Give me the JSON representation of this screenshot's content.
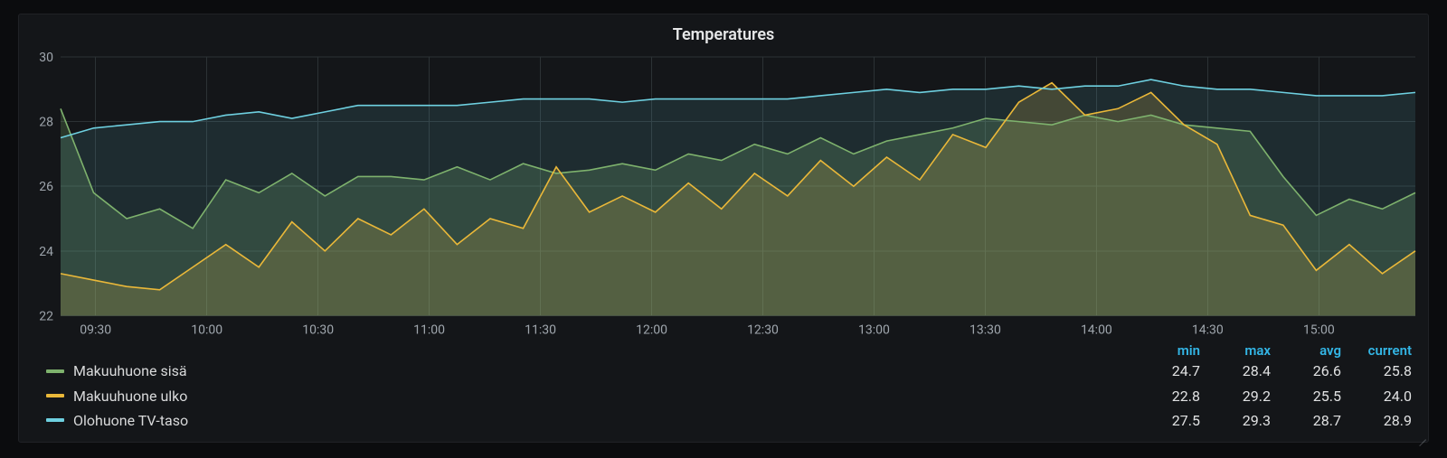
{
  "title": "Temperatures",
  "legend_headers": [
    "min",
    "max",
    "avg",
    "current"
  ],
  "chart_data": {
    "type": "line",
    "ylim": [
      22,
      30
    ],
    "yticks": [
      22,
      24,
      26,
      28,
      30
    ],
    "x": [
      "09:30",
      "10:00",
      "10:30",
      "11:00",
      "11:30",
      "12:00",
      "12:30",
      "13:00",
      "13:30",
      "14:00",
      "14:30",
      "15:00"
    ],
    "series": [
      {
        "name": "Makuuhuone sisä",
        "stats": {
          "min": "24.7",
          "max": "28.4",
          "avg": "26.6",
          "current": "25.8"
        },
        "color": "#7eb26d",
        "fill": "rgba(126,178,109,0.22)",
        "values": [
          28.4,
          25.8,
          25.0,
          25.3,
          24.7,
          26.2,
          25.8,
          26.4,
          25.7,
          26.3,
          26.3,
          26.2,
          26.6,
          26.2,
          26.7,
          26.4,
          26.5,
          26.7,
          26.5,
          27.0,
          26.8,
          27.3,
          27.0,
          27.5,
          27.0,
          27.4,
          27.6,
          27.8,
          28.1,
          28.0,
          27.9,
          28.2,
          28.0,
          28.2,
          27.9,
          27.8,
          27.7,
          26.3,
          25.1,
          25.6,
          25.3,
          25.8
        ]
      },
      {
        "name": "Makuuhuone ulko",
        "stats": {
          "min": "22.8",
          "max": "29.2",
          "avg": "25.5",
          "current": "24.0"
        },
        "color": "#eab839",
        "fill": "rgba(234,184,57,0.20)",
        "values": [
          23.3,
          23.1,
          22.9,
          22.8,
          23.5,
          24.2,
          23.5,
          24.9,
          24.0,
          25.0,
          24.5,
          25.3,
          24.2,
          25.0,
          24.7,
          26.6,
          25.2,
          25.7,
          25.2,
          26.1,
          25.3,
          26.4,
          25.7,
          26.8,
          26.0,
          26.9,
          26.2,
          27.6,
          27.2,
          28.6,
          29.2,
          28.2,
          28.4,
          28.9,
          27.9,
          27.3,
          25.1,
          24.8,
          23.4,
          24.2,
          23.3,
          24.0
        ]
      },
      {
        "name": "Olohuone TV-taso",
        "stats": {
          "min": "27.5",
          "max": "29.3",
          "avg": "28.7",
          "current": "28.9"
        },
        "color": "#6ed0e0",
        "fill": "rgba(110,208,224,0.12)",
        "values": [
          27.5,
          27.8,
          27.9,
          28.0,
          28.0,
          28.2,
          28.3,
          28.1,
          28.3,
          28.5,
          28.5,
          28.5,
          28.5,
          28.6,
          28.7,
          28.7,
          28.7,
          28.6,
          28.7,
          28.7,
          28.7,
          28.7,
          28.7,
          28.8,
          28.9,
          29.0,
          28.9,
          29.0,
          29.0,
          29.1,
          29.0,
          29.1,
          29.1,
          29.3,
          29.1,
          29.0,
          29.0,
          28.9,
          28.8,
          28.8,
          28.8,
          28.9
        ]
      }
    ]
  }
}
